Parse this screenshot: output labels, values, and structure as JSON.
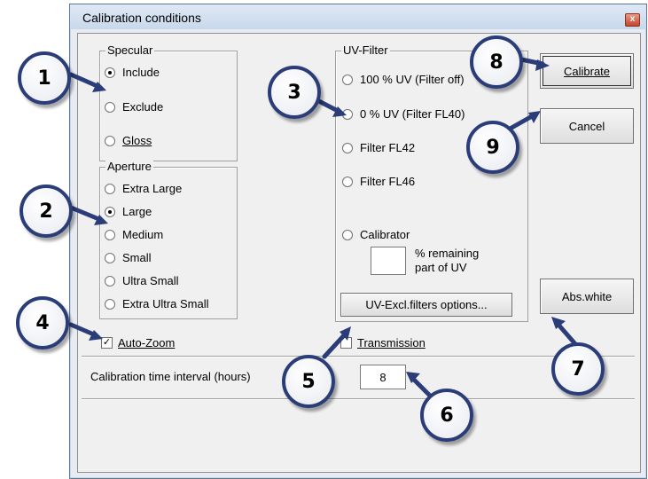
{
  "dialog": {
    "title": "Calibration conditions",
    "close_label": "x"
  },
  "specular": {
    "caption": "Specular",
    "options": [
      "Include",
      "Exclude",
      "Gloss"
    ],
    "selected": "Include"
  },
  "aperture": {
    "caption": "Aperture",
    "options": [
      "Extra Large",
      "Large",
      "Medium",
      "Small",
      "Ultra Small",
      "Extra Ultra Small"
    ],
    "selected": "Large"
  },
  "uv_filter": {
    "caption": "UV-Filter",
    "options": [
      "100 % UV (Filter off)",
      "0 % UV (Filter FL40)",
      "Filter FL42",
      "Filter FL46",
      "Calibrator"
    ],
    "remaining_label_1": "% remaining",
    "remaining_label_2": "part of UV",
    "remaining_value": "",
    "options_button": "UV-Excl.filters options..."
  },
  "buttons": {
    "calibrate": "Calibrate",
    "cancel": "Cancel",
    "abs_white": "Abs.white"
  },
  "auto_zoom": {
    "label": "Auto-Zoom",
    "checked": true,
    "mark": "✓"
  },
  "transmission": {
    "label": "Transmission",
    "checked": false
  },
  "interval": {
    "label": "Calibration time interval (hours)",
    "value": "8"
  },
  "callouts": [
    "1",
    "2",
    "3",
    "4",
    "5",
    "6",
    "7",
    "8",
    "9"
  ],
  "colors": {
    "callout_border": "#2b3d78",
    "arrow": "#2b3d78",
    "title_bar": "#c8d8ec",
    "close_button": "#c4452c"
  }
}
